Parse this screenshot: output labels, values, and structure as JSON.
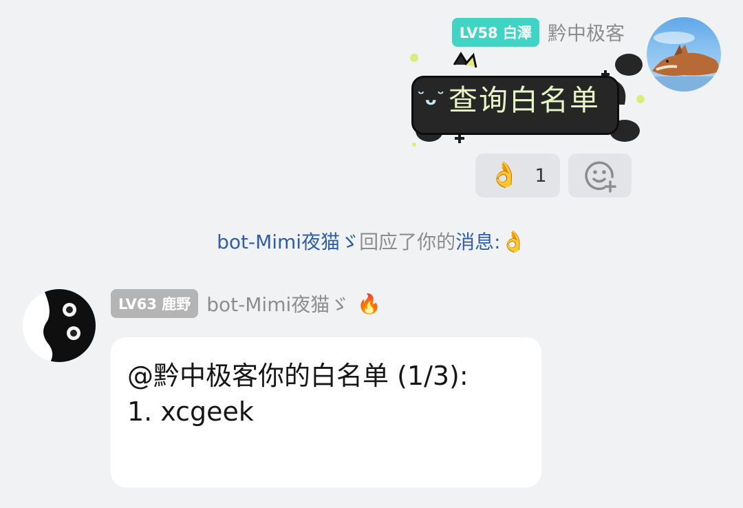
{
  "outgoing": {
    "level_badge": "LV58 白澤",
    "sender_name": "黔中极客",
    "sticker_text": "查询白名单",
    "reactions": [
      {
        "icon": "ok-hand-emoji",
        "glyph": "👌",
        "count": "1"
      }
    ],
    "add_reaction_icon": "add-reaction-smiley-icon"
  },
  "notice": {
    "actor": "bot-Mimi夜猫ゞ",
    "middle": "回应了你的",
    "target": "消息:",
    "emoji": "👌"
  },
  "incoming": {
    "level_badge": "LV63 鹿野",
    "sender_name": "bot-Mimi夜猫ゞ",
    "status_emoji": "🔥",
    "lines": [
      "@黔中极客你的白名单 (1/3):",
      "1. xcgeek"
    ]
  },
  "colors": {
    "background": "#f1f2f4",
    "badge_teal": "#3fd4c4",
    "badge_gray": "#b4b4b4",
    "link_blue": "#2f5ea6",
    "bubble": "#ffffff",
    "reaction_pill": "#e3e4e7"
  }
}
